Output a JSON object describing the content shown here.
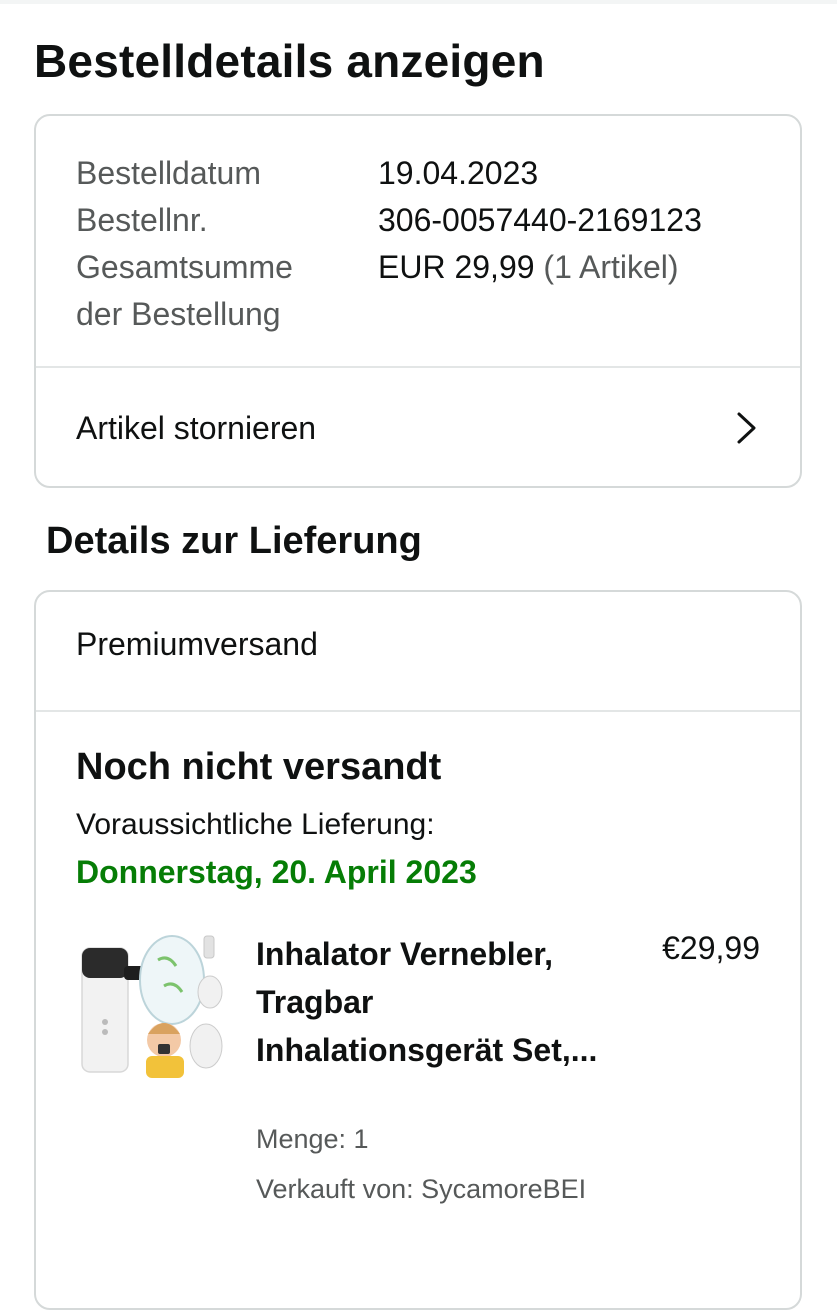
{
  "page": {
    "title": "Bestelldetails anzeigen"
  },
  "summary": {
    "order_date_label": "Bestelldatum",
    "order_date": "19.04.2023",
    "order_number_label": "Bestellnr.",
    "order_number": "306-0057440-2169123",
    "total_label_line1": "Gesamtsumme",
    "total_label_line2": "der Bestellung",
    "total_value": "EUR 29,99",
    "total_items": "(1 Artikel)"
  },
  "actions": {
    "cancel_items": "Artikel stornieren"
  },
  "delivery": {
    "section_title": "Details zur Lieferung",
    "shipping_method": "Premiumversand",
    "status": "Noch nicht versandt",
    "eta_label": "Voraussichtliche Lieferung:",
    "eta_date": "Donnerstag, 20. April 2023",
    "eta_color": "#067d06"
  },
  "item": {
    "title": "Inhalator Vernebler, Tragbar Inhalationsgerät Set,...",
    "price": "€29,99",
    "quantity": "Menge: 1",
    "seller_label": "Verkauft von:",
    "seller_name": "SycamoreBEI",
    "image_icon": "nebulizer-product-image"
  },
  "icons": {
    "cancel_chevron": "chevron-right-icon"
  }
}
